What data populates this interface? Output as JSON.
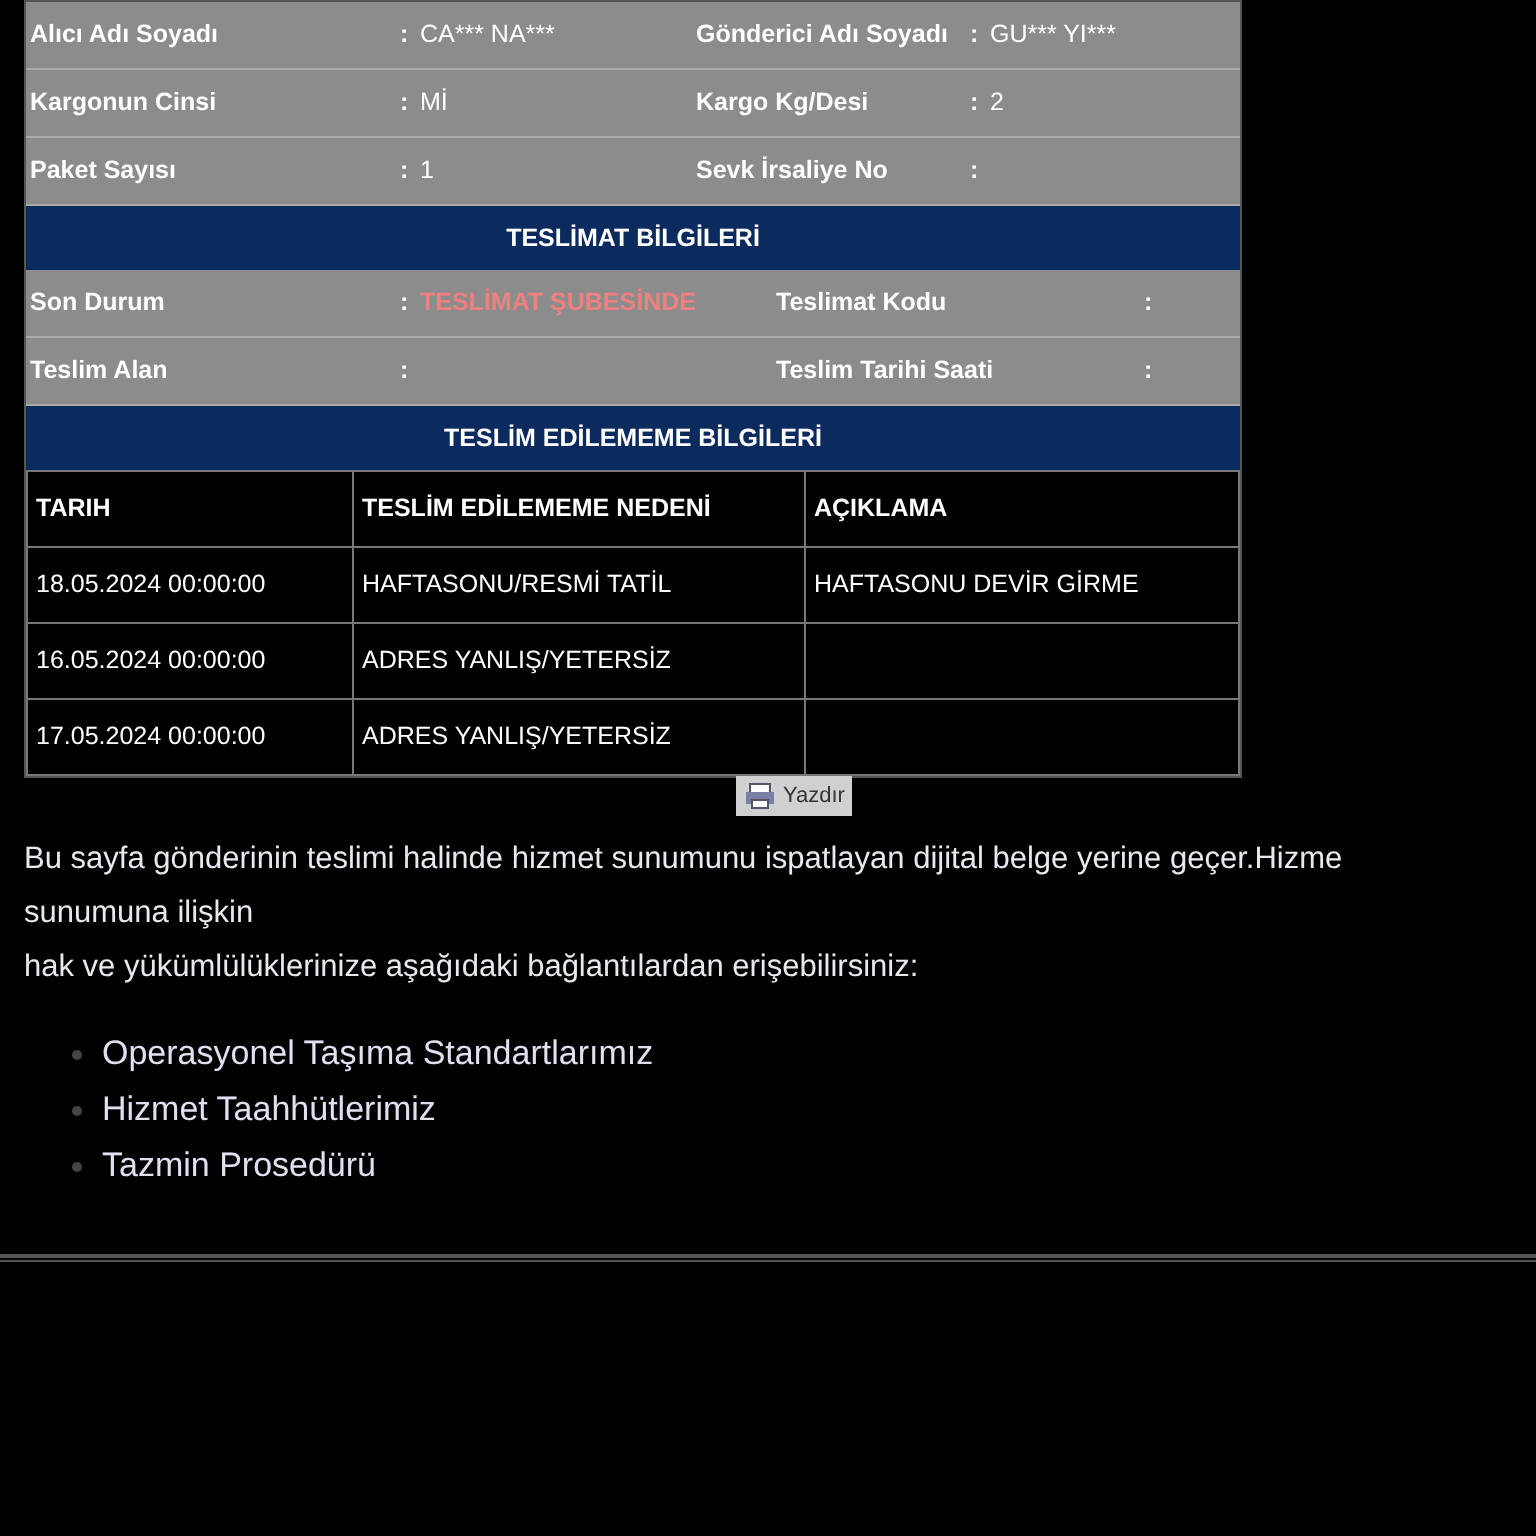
{
  "shipment_rows": [
    {
      "label": "Alıcı Adı Soyadı",
      "colon": ":",
      "value": "CA*** NA***",
      "label_2": "Gönderici Adı Soyadı",
      "colon_2": ":",
      "value_2": "GU*** YI***"
    },
    {
      "label": "Kargonun Cinsi",
      "colon": ":",
      "value": "Mİ",
      "label_2": "Kargo Kg/Desi",
      "colon_2": ":",
      "value_2": "2"
    },
    {
      "label": "Paket Sayısı",
      "colon": ":",
      "value": "1",
      "label_2": "Sevk İrsaliye No",
      "colon_2": ":",
      "value_2": ""
    }
  ],
  "delivery_section": {
    "title": "TESLİMAT BİLGİLERİ",
    "rows": [
      {
        "label": "Son Durum",
        "colon": ":",
        "value": "TESLİMAT ŞUBESİNDE",
        "label_2": "Teslimat Kodu",
        "colon_2": ":"
      },
      {
        "label": "Teslim Alan",
        "colon": ":",
        "value": "",
        "label_2": "Teslim Tarihi Saati",
        "colon_2": ":"
      }
    ]
  },
  "failed_section": {
    "title": "TESLİM EDİLEMEME BİLGİLERİ",
    "columns": [
      "TARIH",
      "TESLİM EDİLEMEME NEDENİ",
      "AÇIKLAMA"
    ],
    "rows": [
      [
        "18.05.2024 00:00:00",
        "HAFTASONU/RESMİ TATİL",
        "HAFTASONU DEVİR GİRME"
      ],
      [
        "16.05.2024 00:00:00",
        "ADRES YANLIŞ/YETERSİZ",
        ""
      ],
      [
        "17.05.2024 00:00:00",
        "ADRES YANLIŞ/YETERSİZ",
        ""
      ]
    ]
  },
  "print_button": "Yazdır",
  "notice_lines": [
    "Bu sayfa gönderinin teslimi halinde hizmet sunumunu ispatlayan dijital belge yerine geçer.Hizme",
    "sunumuna ilişkin",
    "hak ve yükümlülüklerinize aşağıdaki bağlantılardan erişebilirsiniz:"
  ],
  "links": [
    "Operasyonel Taşıma Standartlarımız",
    "Hizmet Taahhütlerimiz",
    "Tazmin Prosedürü"
  ]
}
